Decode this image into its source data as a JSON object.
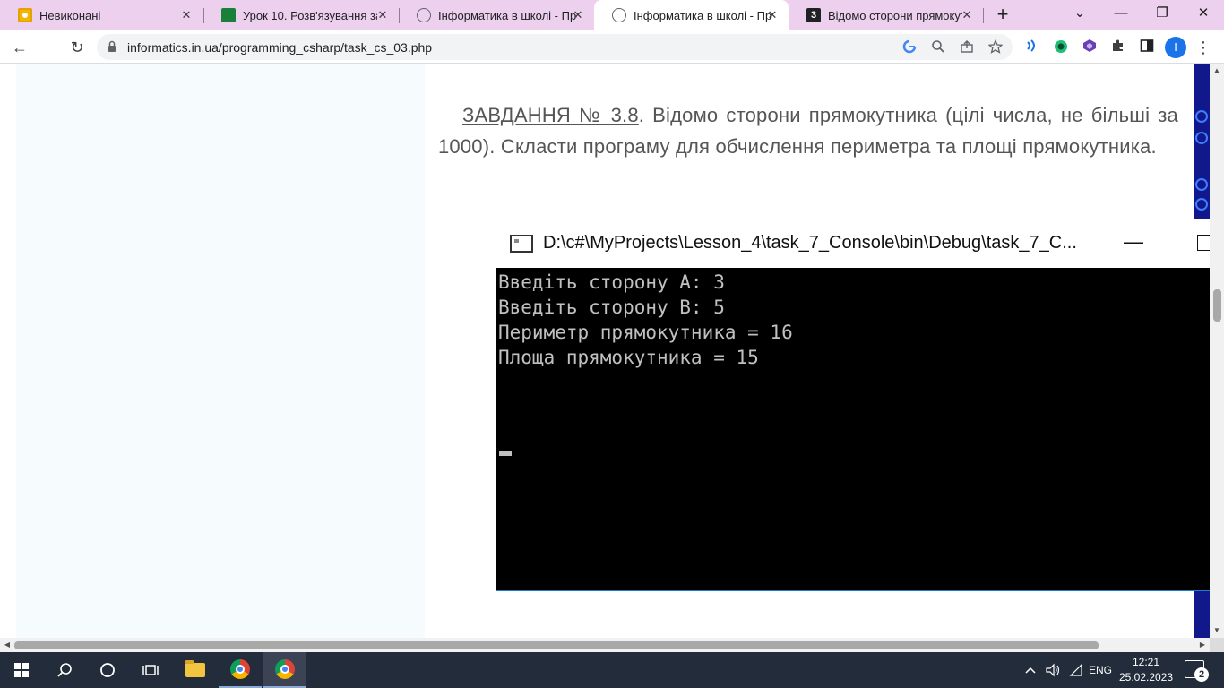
{
  "tabs": [
    {
      "title": "Невиконані",
      "favicon": "classroom-icon"
    },
    {
      "title": "Урок 10. Розв'язування зада",
      "favicon": "sheets-icon"
    },
    {
      "title": "Інформатика в школі - Прог",
      "favicon": "globe-icon"
    },
    {
      "title": "Інформатика в школі - Прог",
      "favicon": "globe-icon",
      "active": true
    },
    {
      "title": "Відомо сторони прямокутн",
      "favicon": "doc-icon"
    }
  ],
  "tab_close_glyph": "✕",
  "new_tab_glyph": "+",
  "window_controls": {
    "dropdown": "⌄",
    "minimize": "—",
    "restore": "❐",
    "close": "✕"
  },
  "toolbar": {
    "back": "←",
    "reload": "↻",
    "url": "informatics.in.ua/programming_csharp/task_cs_03.php",
    "profile_initial": "I",
    "menu": "⋮"
  },
  "article": {
    "task_link": "ЗАВДАННЯ № 3.8",
    "text": ". Відомо сторони прямокутника (цілі числа, не більші за 1000). Скласти програму для обчислення периметра та площі прямокутника."
  },
  "console": {
    "title": "D:\\c#\\MyProjects\\Lesson_4\\task_7_Console\\bin\\Debug\\task_7_C...",
    "lines": [
      "Введіть сторону A: 3",
      "Введіть сторону B: 5",
      "Периметр прямокутника = 16",
      "Площа прямокутника = 15"
    ]
  },
  "taskbar": {
    "language": "ENG",
    "time": "12:21",
    "date": "25.02.2023",
    "notification_count": "2"
  },
  "colors": {
    "tabstrip": "#ecd0ed",
    "console_border": "#1e7bd4",
    "taskbar": "#232c3b",
    "right_strip": "#10188b"
  }
}
